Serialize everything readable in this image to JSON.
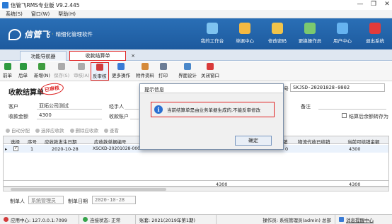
{
  "window": {
    "title": "信管飞RMS专业版 V9.2.445",
    "controls": [
      "—",
      "❐",
      "✕"
    ]
  },
  "menubar": [
    "系统(S)",
    "窗口(W)",
    "帮助(H)"
  ],
  "banner": {
    "brand": "信管飞",
    "separator": "·",
    "slogan": "精细化管理软件"
  },
  "topnav": [
    {
      "label": "我的工作台",
      "icon": "desktop-icon",
      "color": "#7ec3f0"
    },
    {
      "label": "单据中心",
      "icon": "documents-icon",
      "color": "#f5b942"
    },
    {
      "label": "修改密码",
      "icon": "key-icon",
      "color": "#f0c34a"
    },
    {
      "label": "更换操作员",
      "icon": "user-switch-icon",
      "color": "#7bc96f"
    },
    {
      "label": "用户中心",
      "icon": "user-icon",
      "color": "#66b3f0"
    },
    {
      "label": "退出系统",
      "icon": "power-icon",
      "color": "#e23b3b"
    }
  ],
  "tabs": [
    {
      "label": "功能导航器"
    },
    {
      "label": "收款结算单",
      "close": "×"
    }
  ],
  "toolbar": [
    {
      "label": "前单",
      "icon": "arrow-left-icon",
      "color": "#2e9a3f",
      "enabled": true
    },
    {
      "label": "后单",
      "icon": "arrow-right-icon",
      "color": "#2e9a3f",
      "enabled": true
    },
    {
      "label": "新增(N)",
      "icon": "add-icon",
      "color": "#3f9d3f",
      "enabled": true
    },
    {
      "label": "保存(S)",
      "icon": "save-icon",
      "color": "#aaaaaa",
      "enabled": false
    },
    {
      "label": "审核(A)",
      "icon": "check-icon",
      "color": "#aaaaaa",
      "enabled": false
    },
    {
      "label": "反审核",
      "icon": "unaudit-icon",
      "color": "#d23b3b",
      "enabled": true
    },
    {
      "label": "更多操作",
      "icon": "more-icon",
      "color": "#3a7bd5",
      "enabled": true
    },
    {
      "label": "附件资料",
      "icon": "attachment-icon",
      "color": "#d58a3a",
      "enabled": true
    },
    {
      "label": "打印",
      "icon": "print-icon",
      "color": "#6b7c95",
      "enabled": true
    },
    {
      "label": "界面设计",
      "icon": "design-icon",
      "color": "#4a87c9",
      "enabled": true
    },
    {
      "label": "关闭窗口",
      "icon": "close-window-icon",
      "color": "#d93a3a",
      "enabled": true
    }
  ],
  "form": {
    "title": "收款结算单",
    "stamp": "已审核",
    "doc_no_label": "单据编号",
    "doc_no": "SKJSD-20201028-0002",
    "customer_label": "客户",
    "customer": "亚拓公司测试",
    "handler_label": "经手人",
    "handler": "",
    "remark_label": "备注",
    "amount_label": "收款金额",
    "amount": "4300",
    "account_label": "收款账户",
    "account": "",
    "auto_transfer_label": "结算后余额转存为"
  },
  "subtoolbar": [
    "自动分配",
    "选择应收款",
    "删除应收款",
    "查看"
  ],
  "grid": {
    "columns": [
      "选择",
      "序号",
      "应收款发生日期",
      "应收款单据编号",
      "已结销",
      "物流代收已结销",
      "当前可结销金额"
    ],
    "rows": [
      {
        "select": true,
        "index": "1",
        "date": "2020-10-28",
        "doc": "XSCKD-20201028-0003",
        "settled": "0",
        "logistics": "",
        "available": "4300"
      }
    ],
    "totals": {
      "left": "4300",
      "right": "4300"
    }
  },
  "footer": {
    "maker_label": "制单人",
    "maker": "系统管理员",
    "date_label": "制单日期",
    "date": "2020-10-28"
  },
  "statusbar": [
    {
      "text": "应用中心: 127.0.0.1:7099",
      "color": "#d23b3b"
    },
    {
      "text": "连接状态: 正常",
      "color": "#35a34a"
    },
    {
      "text": "账套: 2021(2019年第1期)"
    },
    {
      "text": "操作员: 系统管理员(admin) 总部"
    },
    {
      "text": "消息提醒中心",
      "color": "#3a7bd5"
    }
  ],
  "dialog": {
    "title": "提示信息",
    "message": "当前结算单是由业务单据生成的,不能反审修改",
    "ok": "确定"
  }
}
